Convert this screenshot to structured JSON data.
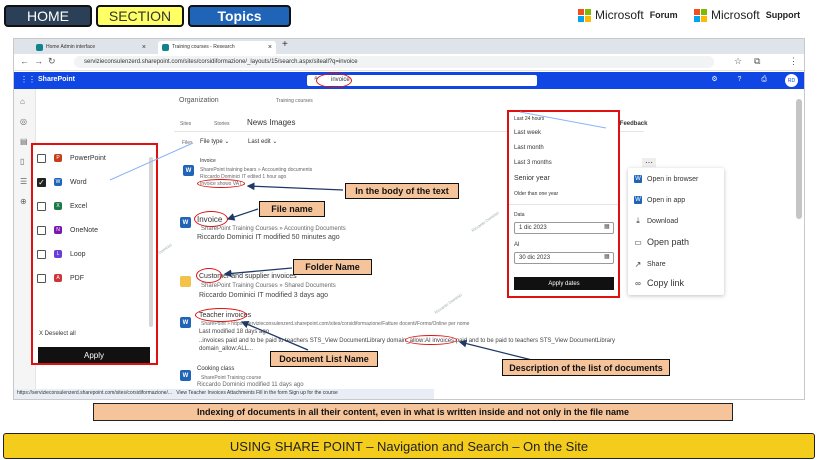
{
  "top_nav": {
    "home": "HOME",
    "section": "SECTION",
    "topics": "Topics"
  },
  "brand_links": [
    {
      "name": "Microsoft",
      "sub": "Forum"
    },
    {
      "name": "Microsoft",
      "sub": "Support"
    }
  ],
  "browser": {
    "tabs": [
      "Home Admin interface",
      "Training courses - Research"
    ],
    "url": "servizieconsulenzerd.sharepoint.com/sites/corsidiformazione/_layouts/15/search.aspx/siteall?q=invoice",
    "app_title": "SharePoint",
    "search_value": "invoice",
    "avatar": "RD"
  },
  "search_page": {
    "breadcrumb_org": "Organization",
    "breadcrumb_site": "Training courses",
    "tab_all": "Sites",
    "tab_stories": "Stories",
    "tab_news": "News Images",
    "feedback": "Feedback",
    "filter_files": "Files",
    "filter_type": "File type",
    "filter_last_edit": "Last edit"
  },
  "file_type_filter": {
    "options": [
      {
        "label": "PowerPoint",
        "checked": false,
        "color": "#c43e1c"
      },
      {
        "label": "Word",
        "checked": true,
        "color": "#1f64b6"
      },
      {
        "label": "Excel",
        "checked": false,
        "color": "#1d7a45"
      },
      {
        "label": "OneNote",
        "checked": false,
        "color": "#7719aa"
      },
      {
        "label": "Loop",
        "checked": false,
        "color": "#6a3ed6"
      },
      {
        "label": "PDF",
        "checked": false,
        "color": "#d13438"
      }
    ],
    "deselect": "X Deselect all",
    "apply": "Apply"
  },
  "date_filter": {
    "options": [
      "Last 24 hours",
      "Last week",
      "Last month",
      "Last 3 months",
      "Senior year",
      "Older than one year"
    ],
    "from_label": "Data",
    "from_value": "1 dic 2023",
    "to_label": "Al",
    "to_value": "30 dic 2023",
    "apply": "Apply dates"
  },
  "context_menu": {
    "items": [
      "Open in browser",
      "Open in app",
      "Download",
      "Open path",
      "Share",
      "Copy link"
    ]
  },
  "results": [
    {
      "title": "Invoice",
      "path": "SharePoint training bears » Accounting documents",
      "meta": "Riccardo Dominici IT edited 1 hour ago",
      "snippet": "Invoice shows VAT..."
    },
    {
      "title": "Invoice",
      "path": "SharePoint Training Courses » Accounting Documents",
      "meta": "Riccardo Dominici IT modified 50 minutes ago"
    },
    {
      "title": "Customer and supplier invoices",
      "path": "SharePoint Training Courses » Shared Documents",
      "meta": "Riccardo Dominici IT modified 3 days ago"
    },
    {
      "title": "Teacher invoices",
      "path": "SharePoint » https://servizieconsulenzerd.sharepoint.com/sites/corsidiformazione/Fatture docenti/Forms/Online per nome",
      "meta": "Last modified 18 days ago",
      "snippet": "..invoices paid and to be paid to teachers STS_View DocumentLibrary domain_allow:AI invoices paid and to be paid to teachers STS_View DocumentLibrary domain_allow:ALL..."
    },
    {
      "title": "Cooking class",
      "path": "SharePoint Training course",
      "meta": "Riccardo Dominici modified 11 days ago"
    }
  ],
  "status_link": "https://servizieconsulenzerd.sharepoint.com/sites/corsidiformazione/...",
  "status_tail": "View Teacher Invoices Attachments Fill in the form Sign up for the course",
  "callouts": {
    "body_text": "In the body of the text",
    "file_name": "File name",
    "folder_name": "Folder Name",
    "doc_list_name": "Document List Name",
    "doc_list_desc": "Description of the list of documents"
  },
  "caption": "Indexing of documents in all their content, even in what is written inside and not only in the file name",
  "footer": "USING SHARE POINT – Navigation and Search – On the Site"
}
